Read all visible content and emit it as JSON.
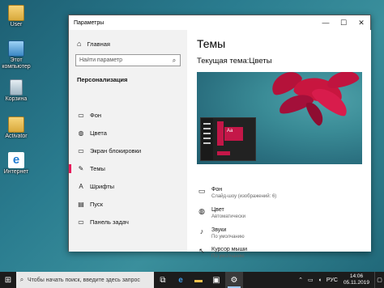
{
  "desktop": {
    "icons": [
      {
        "label": "User",
        "icon": "folder-user-icon"
      },
      {
        "label": "Этот компьютер",
        "icon": "computer-icon"
      },
      {
        "label": "Корзина",
        "icon": "recycle-bin-icon"
      },
      {
        "label": "Activator",
        "icon": "folder-icon"
      },
      {
        "label": "Интернет",
        "icon": "internet-explorer-icon"
      }
    ]
  },
  "window": {
    "title": "Параметры",
    "controls": {
      "minimize": "—",
      "maximize": "☐",
      "close": "✕"
    }
  },
  "sidebar": {
    "home_label": "Главная",
    "search_placeholder": "Найти параметр",
    "section_label": "Персонализация",
    "items": [
      {
        "label": "Фон",
        "icon": "image-icon",
        "glyph": "▭"
      },
      {
        "label": "Цвета",
        "icon": "palette-icon",
        "glyph": "◍"
      },
      {
        "label": "Экран блокировки",
        "icon": "lock-screen-icon",
        "glyph": "▭"
      },
      {
        "label": "Темы",
        "icon": "brush-icon",
        "glyph": "✎",
        "active": true
      },
      {
        "label": "Шрифты",
        "icon": "font-icon",
        "glyph": "A"
      },
      {
        "label": "Пуск",
        "icon": "start-menu-icon",
        "glyph": "▤"
      },
      {
        "label": "Панель задач",
        "icon": "taskbar-icon",
        "glyph": "▭"
      }
    ]
  },
  "content": {
    "title": "Темы",
    "current_theme": "Текущая тема:Цветы",
    "preview_tile_text": "Aa",
    "properties": [
      {
        "name": "Фон",
        "value": "Слайд-шоу (изображений: 6)",
        "icon": "image-icon",
        "glyph": "▭"
      },
      {
        "name": "Цвет",
        "value": "Автоматически",
        "icon": "palette-icon",
        "glyph": "◍"
      },
      {
        "name": "Звуки",
        "value": "По умолчанию",
        "icon": "sound-icon",
        "glyph": "♪"
      },
      {
        "name": "Курсор мыши",
        "value": "По умолчанию",
        "icon": "cursor-icon",
        "glyph": "↖"
      }
    ]
  },
  "taskbar": {
    "search_placeholder": "Чтобы начать поиск, введите здесь запрос",
    "apps": [
      {
        "icon": "task-view-icon",
        "glyph": "⧉"
      },
      {
        "icon": "edge-icon",
        "glyph": "e"
      },
      {
        "icon": "file-explorer-icon",
        "glyph": "▬"
      },
      {
        "icon": "store-icon",
        "glyph": "▣"
      },
      {
        "icon": "settings-icon",
        "glyph": "⚙",
        "active": true
      }
    ],
    "language": "РУС",
    "time": "14:06",
    "date": "05.11.2019"
  },
  "colors": {
    "accent": "#e81c5d",
    "taskbar": "#1c1c1c",
    "sidebar": "#f2f2f2"
  }
}
